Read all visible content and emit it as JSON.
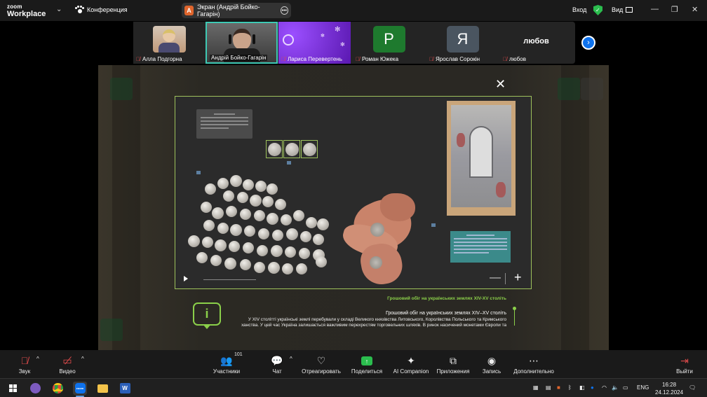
{
  "app": {
    "brand_line1": "zoom",
    "brand_line2": "Workplace",
    "conference_label": "Конференция"
  },
  "share_tab": {
    "letter": "A",
    "label": "Экран (Андрій Бойко-Гагарін)"
  },
  "top_right": {
    "login": "Вход",
    "view": "Вид"
  },
  "participants": [
    {
      "name": "Алла Подгорна",
      "kind": "photo",
      "muted": true
    },
    {
      "name": "Андрій Бойко-Гагарін",
      "kind": "video",
      "muted": false,
      "active": true
    },
    {
      "name": "Лариса Перевертень",
      "kind": "image",
      "muted": true
    },
    {
      "name": "Роман Южека",
      "kind": "letter",
      "letter": "Р",
      "color": "#1e7a2e",
      "muted": true
    },
    {
      "name": "Ярослав Сорокін",
      "kind": "letter",
      "letter": "Я",
      "color": "#4a5560",
      "muted": true
    },
    {
      "name": "любов",
      "kind": "name",
      "display": "любов",
      "muted": true
    }
  ],
  "viewer": {
    "heading_green": "Грошовий обіг на українських землях XIV-XV століть",
    "subheading": "Грошовий обіг на українських землях XIV–XV століть",
    "body": "У XIV столітті українські землі перебували у складі Великого князівства Литовського, Королівства Польського та Кримського ханства. У цей час Україна залишається важливим перехрестям торговельних шляхів. В ринок насичений монетами Європи та",
    "info_icon": "i"
  },
  "toolbar": {
    "sound": "Звук",
    "video": "Видео",
    "participants": "Участники",
    "participants_count": "101",
    "chat": "Чат",
    "react": "Отреагировать",
    "share": "Поделиться",
    "ai": "AI Companion",
    "apps": "Приложения",
    "record": "Запись",
    "more": "Дополнительно",
    "leave": "Выйти"
  },
  "taskbar": {
    "lang": "ENG",
    "time": "16:28",
    "date": "24.12.2024",
    "zoom_label": "zoom",
    "word_label": "W"
  }
}
